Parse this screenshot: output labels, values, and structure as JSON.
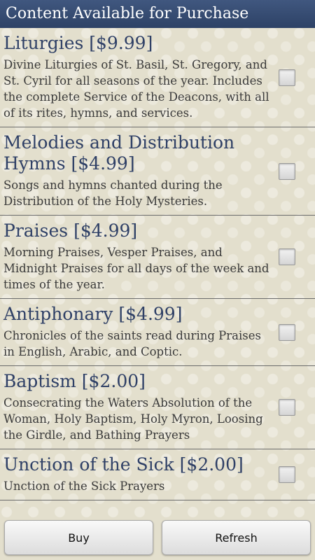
{
  "header": {
    "title": "Content Available for Purchase"
  },
  "items": [
    {
      "title": "Liturgies [$9.99]",
      "description": "Divine Liturgies of St. Basil, St. Gregory, and St. Cyril for all seasons of the year. Includes the complete Service of the Deacons, with all of its rites, hymns, and services.",
      "checked": false
    },
    {
      "title": "Melodies and Distribution Hymns [$4.99]",
      "description": "Songs and hymns chanted during the Distribution of the Holy Mysteries.",
      "checked": false
    },
    {
      "title": "Praises [$4.99]",
      "description": "Morning Praises, Vesper Praises, and Midnight Praises for all days of the week and times of the year.",
      "checked": false
    },
    {
      "title": "Antiphonary [$4.99]",
      "description": "Chronicles of the saints read during Praises in English, Arabic, and Coptic.",
      "checked": false
    },
    {
      "title": "Baptism [$2.00]",
      "description": "Consecrating the Waters Absolution of the Woman, Holy Baptism, Holy Myron, Loosing the Girdle, and Bathing Prayers",
      "checked": false
    },
    {
      "title": "Unction of the Sick [$2.00]",
      "description": "Unction of the Sick Prayers",
      "checked": false
    }
  ],
  "buttons": {
    "buy_label": "Buy",
    "refresh_label": "Refresh"
  }
}
